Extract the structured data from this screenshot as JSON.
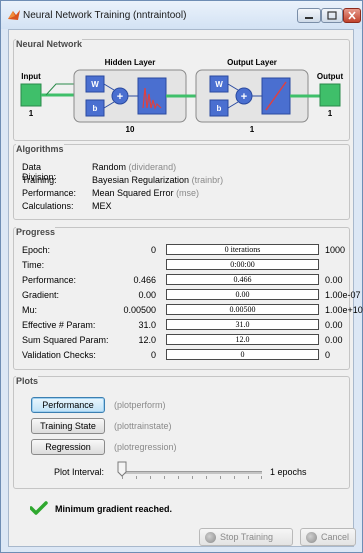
{
  "window": {
    "title": "Neural Network Training (nntraintool)"
  },
  "network": {
    "section_title": "Neural Network",
    "input_label": "Input",
    "input_size": "1",
    "hidden_title": "Hidden Layer",
    "hidden_size": "10",
    "output_title": "Output Layer",
    "output_size": "1",
    "output_label": "Output",
    "output_out_size": "1",
    "w_label": "W",
    "b_label": "b",
    "plus_label": "+"
  },
  "algorithms": {
    "section_title": "Algorithms",
    "rows": [
      {
        "key": "Data Division:",
        "value": "Random",
        "fn": "(dividerand)"
      },
      {
        "key": "Training:",
        "value": "Bayesian Regularization",
        "fn": "(trainbr)"
      },
      {
        "key": "Performance:",
        "value": "Mean Squared Error",
        "fn": "(mse)"
      },
      {
        "key": "Calculations:",
        "value": "MEX",
        "fn": ""
      }
    ]
  },
  "progress": {
    "section_title": "Progress",
    "rows": [
      {
        "label": "Epoch:",
        "min": "0",
        "current": "0 iterations",
        "max": "1000"
      },
      {
        "label": "Time:",
        "min": "",
        "current": "0:00:00",
        "max": ""
      },
      {
        "label": "Performance:",
        "min": "0.466",
        "current": "0.466",
        "max": "0.00"
      },
      {
        "label": "Gradient:",
        "min": "0.00",
        "current": "0.00",
        "max": "1.00e-07"
      },
      {
        "label": "Mu:",
        "min": "0.00500",
        "current": "0.00500",
        "max": "1.00e+10"
      },
      {
        "label": "Effective # Param:",
        "min": "31.0",
        "current": "31.0",
        "max": "0.00"
      },
      {
        "label": "Sum Squared Param:",
        "min": "12.0",
        "current": "12.0",
        "max": "0.00"
      },
      {
        "label": "Validation Checks:",
        "min": "0",
        "current": "0",
        "max": "0"
      }
    ]
  },
  "plots": {
    "section_title": "Plots",
    "buttons": [
      {
        "label": "Performance",
        "fn": "(plotperform)"
      },
      {
        "label": "Training State",
        "fn": "(plottrainstate)"
      },
      {
        "label": "Regression",
        "fn": "(plotregression)"
      }
    ],
    "interval_label": "Plot Interval:",
    "interval_value": "1 epochs"
  },
  "status": {
    "message": "Minimum gradient reached."
  },
  "footer": {
    "stop_label": "Stop Training",
    "cancel_label": "Cancel"
  },
  "colors": {
    "accent_green": "#3fbf6a",
    "box_blue": "#4a6fd0",
    "check_green": "#2fa82f"
  }
}
